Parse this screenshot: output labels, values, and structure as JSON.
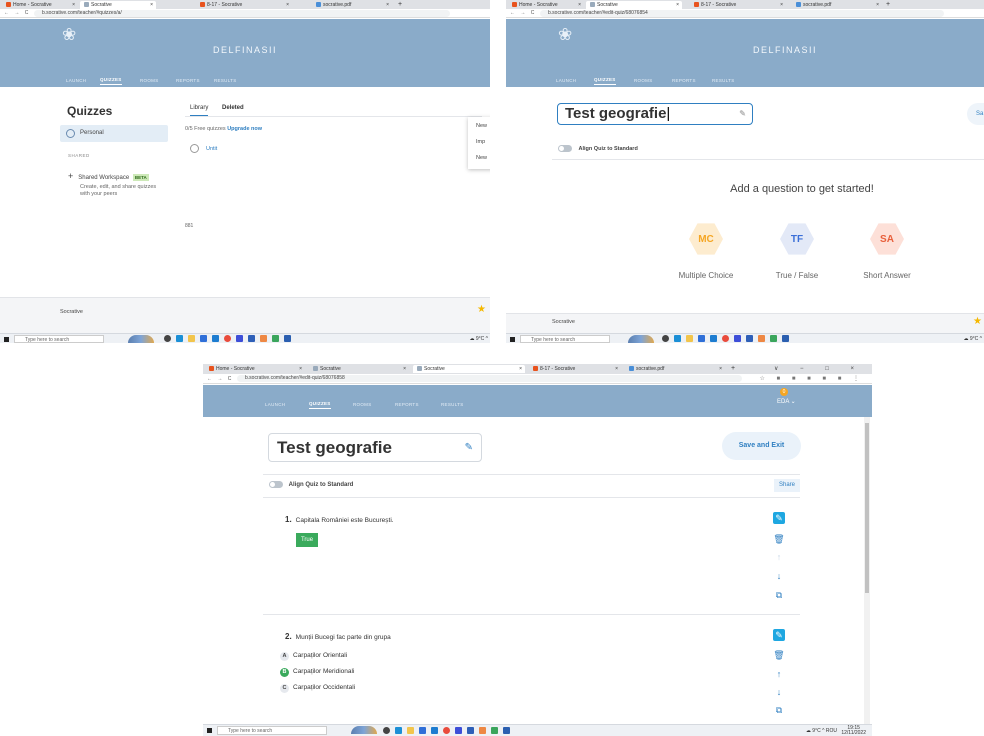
{
  "colors": {
    "appbar": "#8aabc9",
    "accent": "#1ea7e1",
    "correct": "#3aaa5c",
    "mc": "#f5a623",
    "tf": "#3b6fd8",
    "sa": "#e8603c",
    "badge": "#f5a623"
  },
  "shot1": {
    "tabs": [
      "Home - Socrative",
      "Socrative",
      "8-17 - Socrative",
      "socrative.pdf"
    ],
    "url": "b.socrative.com/teacher/#quizzes/a/",
    "brand": "DELFINASII",
    "nav": [
      "LAUNCH",
      "QUIZZES",
      "ROOMS",
      "REPORTS",
      "RESULTS"
    ],
    "heading": "Quizzes",
    "personal": "Personal",
    "shared_label": "SHARED",
    "workspace": "Shared Workspace",
    "beta": "BETA",
    "workspace_desc": "Create, edit, and share quizzes with your peers",
    "lib_tabs": [
      "Library",
      "Deleted"
    ],
    "free_text": "0/5 Free quizzes",
    "upgrade": "Upgrade now",
    "quiz_item": "Untit",
    "menu": [
      "New",
      "Imp",
      "New"
    ],
    "count": "881",
    "footer": "Socrative",
    "search": "Type here to search"
  },
  "shot2": {
    "tabs": [
      "Home - Socrative",
      "Socrative",
      "8-17 - Socrative",
      "socrative.pdf"
    ],
    "url": "b.socrative.com/teacher/#edit-quiz/68076854",
    "brand": "DELFINASII",
    "nav": [
      "LAUNCH",
      "QUIZZES",
      "ROOMS",
      "REPORTS",
      "RESULTS"
    ],
    "title_input": "Test geografie",
    "save_partial": "Sa",
    "align": "Align Quiz to Standard",
    "prompt": "Add a question to get started!",
    "types": [
      {
        "code": "MC",
        "label": "Multiple Choice"
      },
      {
        "code": "TF",
        "label": "True / False"
      },
      {
        "code": "SA",
        "label": "Short Answer"
      }
    ],
    "footer": "Socrative",
    "search": "Type here to search",
    "tray": "9°C"
  },
  "shot3": {
    "tabs": [
      "Home - Socrative",
      "Socrative",
      "Socrative",
      "8-17 - Socrative",
      "socrative.pdf"
    ],
    "url": "b.socrative.com/teacher/#edit-quiz/68076858",
    "nav": [
      "LAUNCH",
      "QUIZZES",
      "ROOMS",
      "REPORTS",
      "RESULTS"
    ],
    "badge": "0",
    "user": "EDA",
    "quiz_title": "Test geografie",
    "save_exit": "Save and Exit",
    "align": "Align Quiz to Standard",
    "share": "Share",
    "q1": {
      "num": "1.",
      "text": "Capitala României este București.",
      "answer": "True"
    },
    "q2": {
      "num": "2.",
      "text": "Munții Bucegi fac parte din grupa",
      "options": [
        {
          "letter": "A",
          "text": "Carpaților Orientali",
          "correct": false
        },
        {
          "letter": "B",
          "text": "Carpaților Meridionali",
          "correct": true
        },
        {
          "letter": "C",
          "text": "Carpaților Occidentali",
          "correct": false
        }
      ]
    },
    "search": "Type here to search",
    "tray": "9°C",
    "time": "19:15",
    "date": "12/11/2022",
    "lang": "ROU"
  }
}
